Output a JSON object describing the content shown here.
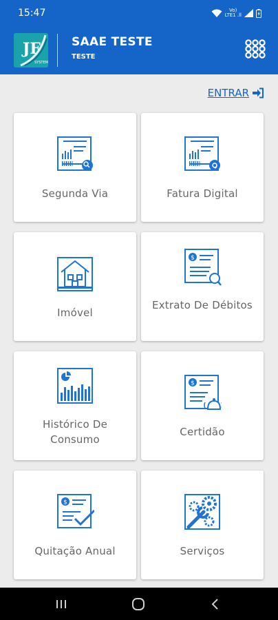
{
  "status_bar": {
    "time": "15:47",
    "network_top": "Vo)",
    "network_bottom": "LTE1 .ll"
  },
  "header": {
    "title": "SAAE TESTE",
    "subtitle": "TESTE",
    "logo_caption": "SYSTEM"
  },
  "login_link": "ENTRAR",
  "tiles": [
    {
      "label": "Segunda Via",
      "icon": "bill-search-icon"
    },
    {
      "label": "Fatura Digital",
      "icon": "bill-email-icon"
    },
    {
      "label": "Imóvel",
      "icon": "house-icon"
    },
    {
      "label": "Extrato De Débitos",
      "icon": "debt-statement-icon"
    },
    {
      "label": "Histórico De Consumo",
      "icon": "consumption-chart-icon"
    },
    {
      "label": "Certidão",
      "icon": "certificate-icon"
    },
    {
      "label": "Quitação Anual",
      "icon": "annual-discharge-icon"
    },
    {
      "label": "Serviços",
      "icon": "services-tools-icon"
    }
  ],
  "colors": {
    "primary": "#1565c8",
    "icon_blue": "#1e74d6",
    "background": "#ececec"
  }
}
